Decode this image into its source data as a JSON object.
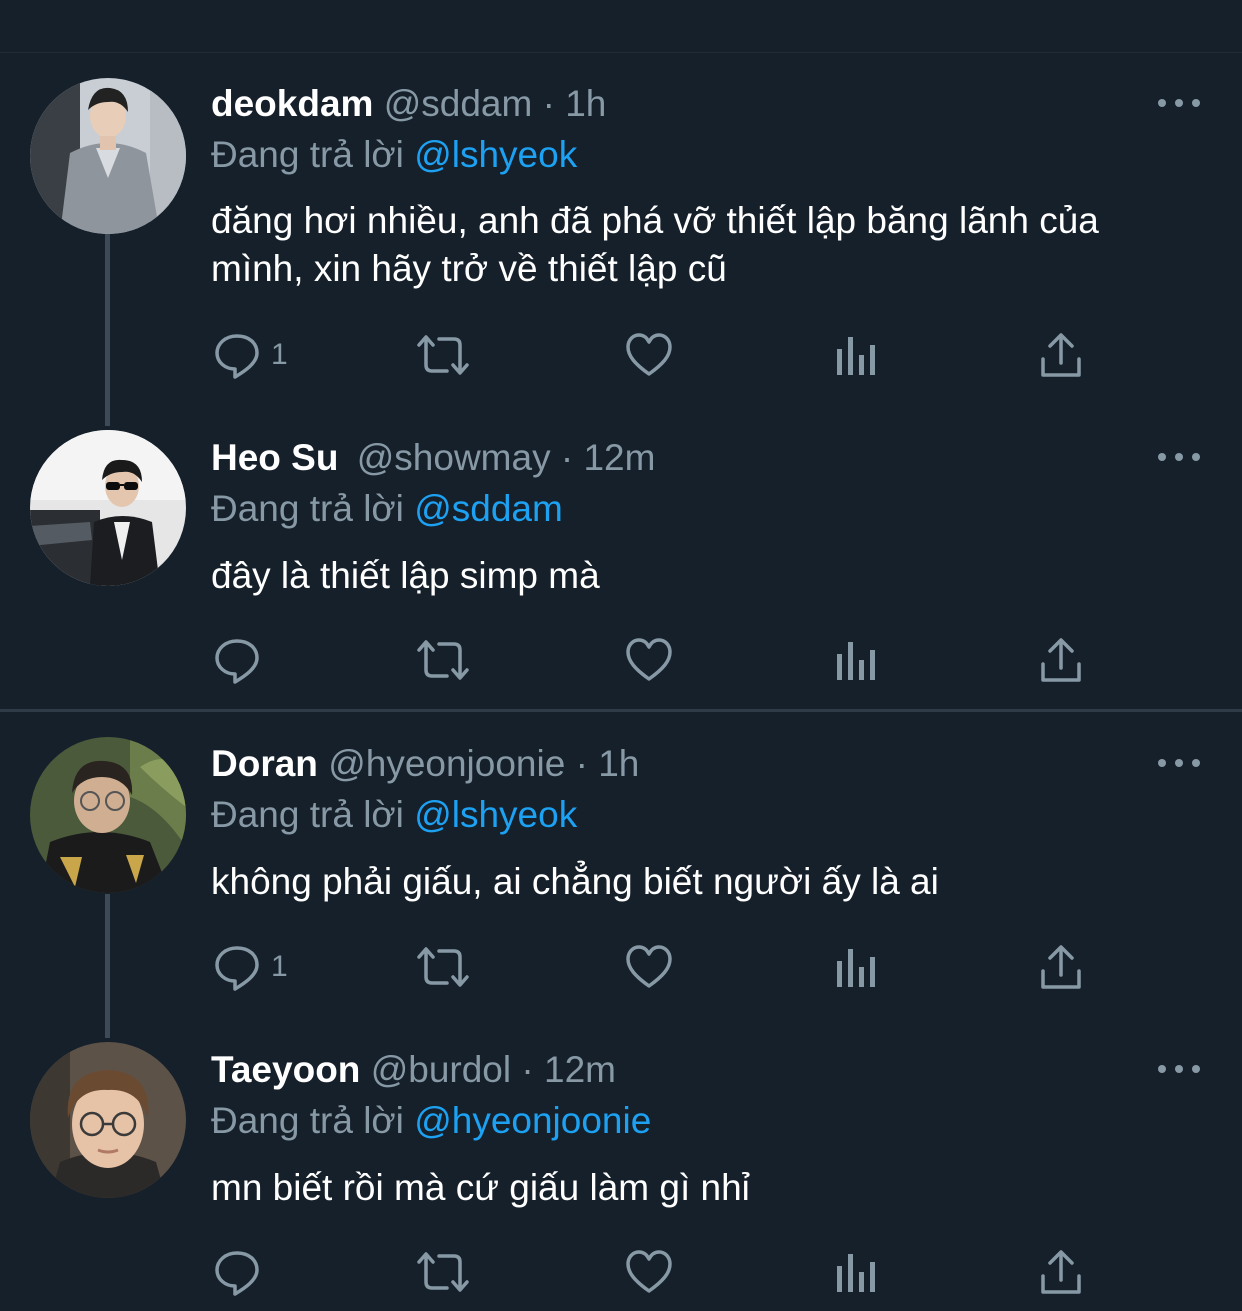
{
  "colors": {
    "background": "#15202b",
    "text_primary": "#ffffff",
    "text_secondary": "#8899a6",
    "mention": "#1da1f2",
    "thread_line": "#3d4a57"
  },
  "tweets": [
    {
      "name": "deokdam",
      "handle": "@sddam",
      "separator": "·",
      "time": "1h",
      "replying_prefix": "Đang trả lời",
      "replying_to": "@lshyeok",
      "text": "đăng hơi nhiều, anh đã phá vỡ thiết lập băng lãnh của mình, xin hãy trở về thiết lập cũ",
      "reply_count": "1",
      "icons": [
        "reply-icon",
        "retweet-icon",
        "like-icon",
        "analytics-icon",
        "share-icon",
        "more-icon"
      ]
    },
    {
      "name": "Heo Su",
      "handle": "@showmay",
      "separator": "·",
      "time": "12m",
      "replying_prefix": "Đang trả lời",
      "replying_to": "@sddam",
      "text": "đây là thiết lập simp mà",
      "reply_count": "",
      "icons": [
        "reply-icon",
        "retweet-icon",
        "like-icon",
        "analytics-icon",
        "share-icon",
        "more-icon"
      ]
    },
    {
      "name": "Doran",
      "handle": "@hyeonjoonie",
      "separator": "·",
      "time": "1h",
      "replying_prefix": "Đang trả lời",
      "replying_to": "@lshyeok",
      "text": "không phải giấu, ai chẳng biết người ấy là ai",
      "reply_count": "1",
      "icons": [
        "reply-icon",
        "retweet-icon",
        "like-icon",
        "analytics-icon",
        "share-icon",
        "more-icon"
      ]
    },
    {
      "name": "Taeyoon",
      "handle": "@burdol",
      "separator": "·",
      "time": "12m",
      "replying_prefix": "Đang trả lời",
      "replying_to": "@hyeonjoonie",
      "text": "mn biết rồi mà cứ giấu làm gì nhỉ",
      "reply_count": "",
      "icons": [
        "reply-icon",
        "retweet-icon",
        "like-icon",
        "analytics-icon",
        "share-icon",
        "more-icon"
      ]
    }
  ]
}
